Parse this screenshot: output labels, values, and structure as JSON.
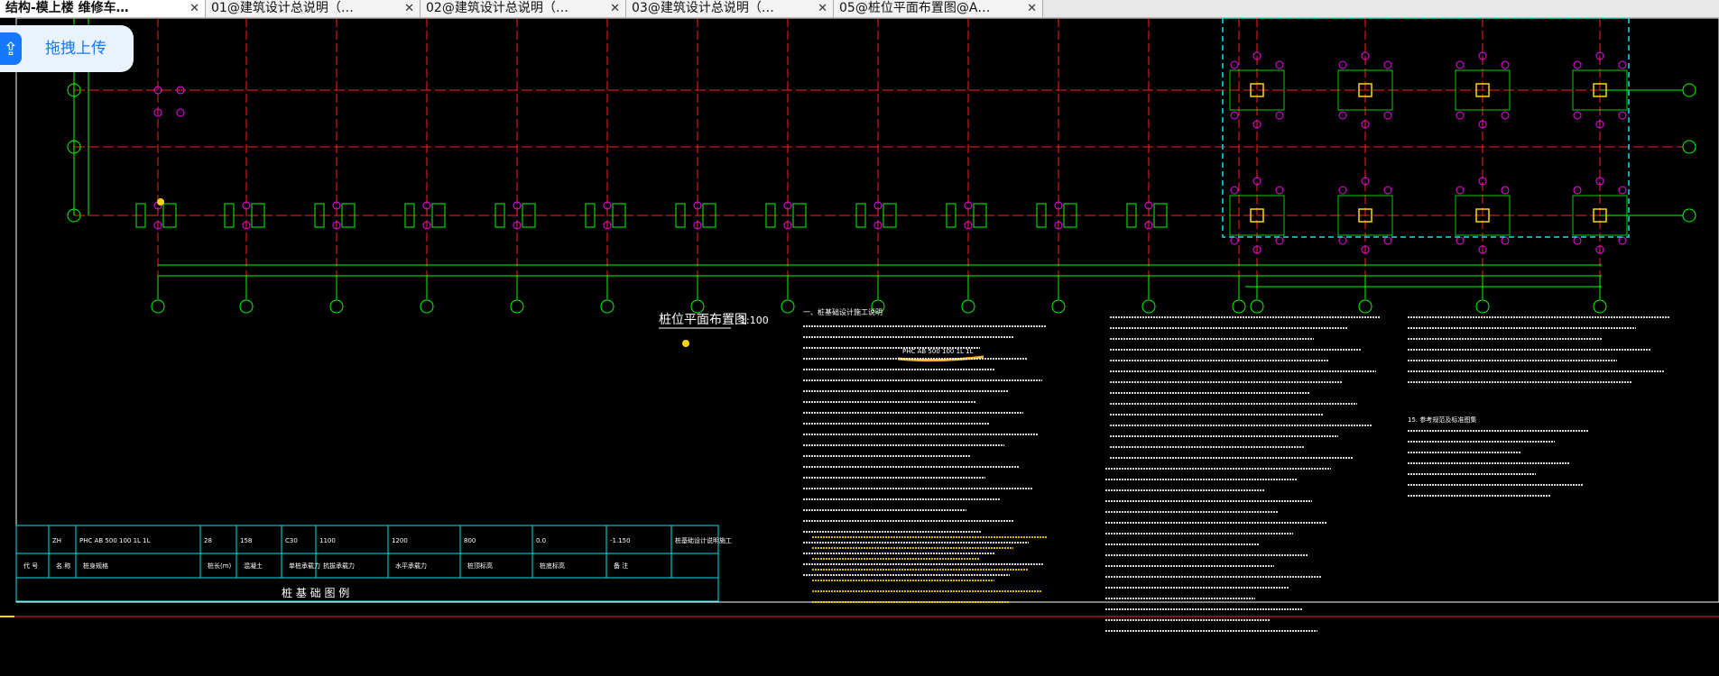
{
  "tabs": [
    {
      "label": "结构-模上楼 维修车…",
      "active": true
    },
    {
      "label": "01@建筑设计总说明（…",
      "active": false
    },
    {
      "label": "02@建筑设计总说明（…",
      "active": false
    },
    {
      "label": "03@建筑设计总说明（…",
      "active": false
    },
    {
      "label": "05@桩位平面布置图@A…",
      "active": false
    }
  ],
  "close_glyph": "✕",
  "upload": {
    "label": "拖拽上传"
  },
  "drawing": {
    "title": "桩位平面布置图",
    "scale": "1:100",
    "note_pile_type": "PHC AB 500 100 1L 1L",
    "legend_title": "桩 基 础 图 例",
    "legend_row1": [
      "ZH",
      "PHC AB 500 100 1L 1L",
      "28",
      "158",
      "C30",
      "1100",
      "1200",
      "800",
      "0.0",
      "-1.150",
      "桩基础设计说明施工"
    ],
    "legend_row2": [
      "代 号",
      "名 称",
      "桩身规格",
      "桩长(m)",
      "混凝土",
      "单桩承载力",
      "抗拔承载力",
      "水平承载力",
      "桩顶标高",
      "桩底标高",
      "备 注"
    ],
    "notes_title": "一、桩基础设计施工说明",
    "right_title": "15. 参考规范及标准图集"
  },
  "colors": {
    "grid_red": "#ff2020",
    "green": "#00ff00",
    "magenta": "#ff00ff",
    "cyan": "#00e5ee",
    "yellow": "#ffd400",
    "white": "#ffffff",
    "orange": "#ffb020"
  }
}
